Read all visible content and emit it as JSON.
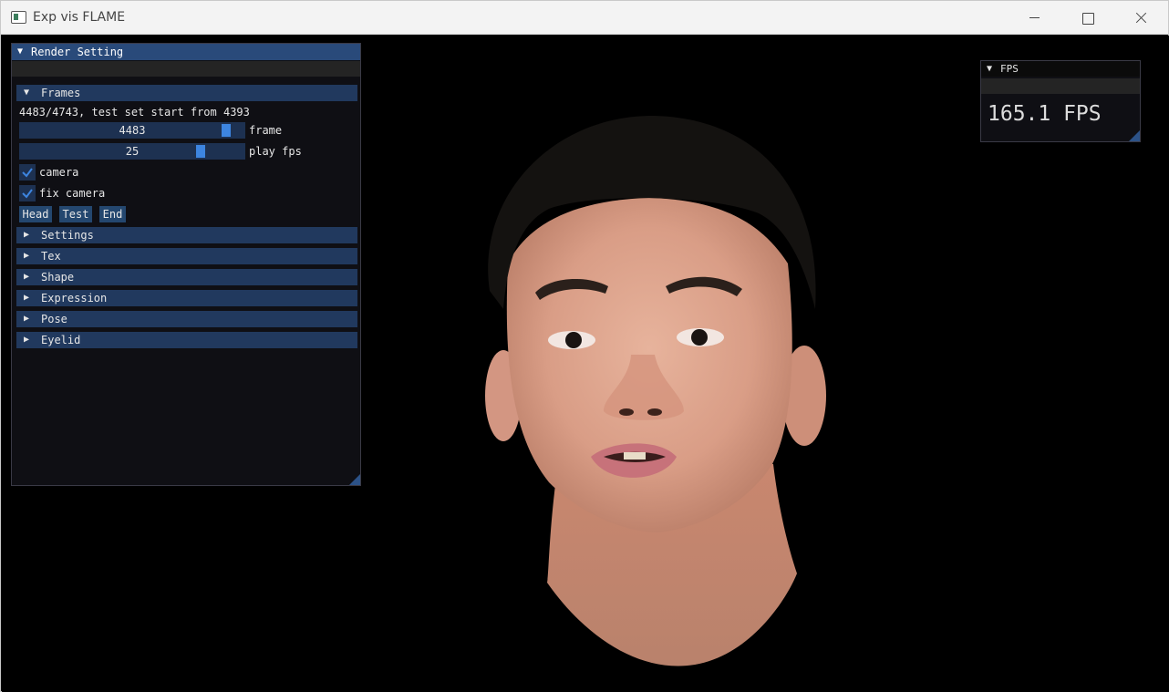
{
  "window": {
    "title": "Exp vis FLAME"
  },
  "render_setting": {
    "title": "Render Setting",
    "frames_header": "Frames",
    "status": "4483/4743, test set start from 4393",
    "frame_slider": {
      "value": "4483",
      "label": "frame",
      "fraction": 0.94
    },
    "fps_slider": {
      "value": "25",
      "label": "play fps",
      "fraction": 0.82
    },
    "camera_checkbox": {
      "label": "camera",
      "checked": true
    },
    "fix_camera_checkbox": {
      "label": "fix camera",
      "checked": true
    },
    "buttons": [
      "Head",
      "Test",
      "End"
    ],
    "sections": [
      "Settings",
      "Tex",
      "Shape",
      "Expression",
      "Pose",
      "Eyelid"
    ]
  },
  "fps_window": {
    "title": "FPS",
    "value": "165.1 FPS"
  },
  "icons": {
    "expanded": "triangle-down-icon",
    "collapsed": "triangle-right-icon",
    "check": "checkmark-icon"
  },
  "colors": {
    "title_active": "#294a7a",
    "header": "#21395e",
    "frame_bg": "#1d3151",
    "slider_grab": "#3d85e0",
    "window_bg": "#0f0f14"
  }
}
